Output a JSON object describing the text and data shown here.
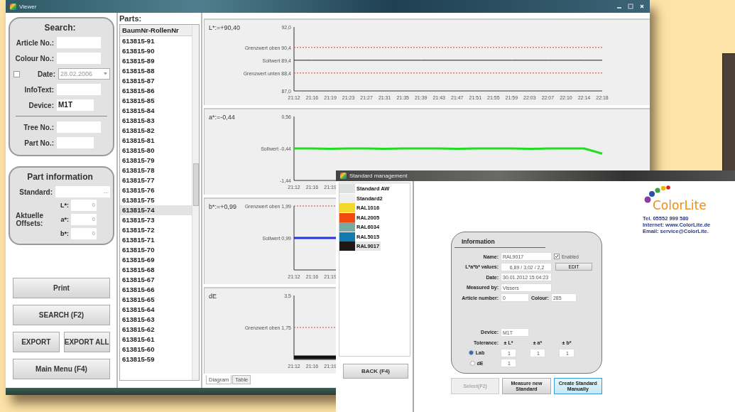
{
  "viewer": {
    "title": "Viewer",
    "search": {
      "heading": "Search:",
      "fields": [
        {
          "label": "Article No.:",
          "kind": "text"
        },
        {
          "label": "Colour No.:",
          "kind": "text"
        },
        {
          "label": "Date:",
          "kind": "date",
          "value": "28.02.2006",
          "checked": false
        },
        {
          "label": "InfoText:",
          "kind": "text"
        },
        {
          "label": "Device:",
          "kind": "short",
          "value": "M1T"
        }
      ],
      "part_fields": [
        {
          "label": "Tree No.:",
          "kind": "text"
        },
        {
          "label": "Part No.:",
          "kind": "short"
        }
      ]
    },
    "part_information": {
      "heading": "Part information",
      "standard_label": "Standard:",
      "standard_button": "...",
      "offsets_label": "Aktuelle Offsets:",
      "offsets": [
        {
          "label": "L*:",
          "value": "0"
        },
        {
          "label": "a*:",
          "value": "0"
        },
        {
          "label": "b*:",
          "value": "0"
        }
      ]
    },
    "buttons": [
      "Print",
      "SEARCH (F2)",
      "EXPORT",
      "EXPORT ALL",
      "Main Menu (F4)"
    ],
    "parts": {
      "heading": "Parts:",
      "column": "BaumNr-RollenNr",
      "rows": [
        {
          "text": "613815-91",
          "selected": false
        },
        {
          "text": "613815-90",
          "selected": false
        },
        {
          "text": "613815-89",
          "selected": false
        },
        {
          "text": "613815-88",
          "selected": false
        },
        {
          "text": "613815-87",
          "selected": false
        },
        {
          "text": "613815-86",
          "selected": false
        },
        {
          "text": "613815-85",
          "selected": false
        },
        {
          "text": "613815-84",
          "selected": false
        },
        {
          "text": "613815-83",
          "selected": false
        },
        {
          "text": "613815-82",
          "selected": false
        },
        {
          "text": "613815-81",
          "selected": false
        },
        {
          "text": "613815-80",
          "selected": false
        },
        {
          "text": "613815-79",
          "selected": false
        },
        {
          "text": "613815-78",
          "selected": false
        },
        {
          "text": "613815-77",
          "selected": false
        },
        {
          "text": "613815-76",
          "selected": false
        },
        {
          "text": "613815-75",
          "selected": false
        },
        {
          "text": "613815-74",
          "selected": true
        },
        {
          "text": "613815-73",
          "selected": false
        },
        {
          "text": "613815-72",
          "selected": false
        },
        {
          "text": "613815-71",
          "selected": false
        },
        {
          "text": "613815-70",
          "selected": false
        },
        {
          "text": "613815-69",
          "selected": false
        },
        {
          "text": "613815-68",
          "selected": false
        },
        {
          "text": "613815-67",
          "selected": false
        },
        {
          "text": "613815-66",
          "selected": false
        },
        {
          "text": "613815-65",
          "selected": false
        },
        {
          "text": "613815-64",
          "selected": false
        },
        {
          "text": "613815-63",
          "selected": false
        },
        {
          "text": "613815-62",
          "selected": false
        },
        {
          "text": "613815-61",
          "selected": false
        },
        {
          "text": "613815-60",
          "selected": false
        },
        {
          "text": "613815-59",
          "selected": false
        }
      ]
    },
    "charts": [
      {
        "label": "L*:=+90,40",
        "chart_data": {
          "type": "line",
          "ylim": [
            87,
            92
          ],
          "yticks": [
            {
              "value": 92,
              "label": "92,0"
            },
            {
              "value": 90.4,
              "label": "Grenzwert oben 90,4"
            },
            {
              "value": 89.4,
              "label": "Sollwert 89,4"
            },
            {
              "value": 88.4,
              "label": "Grenzwert unten 88,4"
            },
            {
              "value": 87,
              "label": "87,0"
            }
          ],
          "categories": [
            "21:12",
            "21:16",
            "21:19",
            "21:23",
            "21:27",
            "21:31",
            "21:35",
            "21:39",
            "21:43",
            "21:47",
            "21:51",
            "21:55",
            "21:59",
            "22:03",
            "22:07",
            "22:10",
            "22:14",
            "22:18"
          ],
          "series": [
            {
              "color": "#d04040",
              "line_style": "dashed",
              "values": [
                90.4,
                90.4,
                90.4,
                90.4,
                90.4,
                90.4,
                90.4,
                90.4,
                90.4,
                90.4,
                90.4,
                90.4,
                90.4,
                90.4,
                90.4,
                90.4,
                90.4,
                90.4
              ]
            },
            {
              "color": "#222222",
              "line_style": "solid",
              "values": [
                89.4,
                89.4,
                89.4,
                89.4,
                89.4,
                89.4,
                89.4,
                89.4,
                89.4,
                89.4,
                89.4,
                89.4,
                89.4,
                89.4,
                89.4,
                89.4,
                89.4,
                89.4
              ]
            },
            {
              "color": "#d04040",
              "line_style": "dashed",
              "values": [
                88.4,
                88.4,
                88.4,
                88.4,
                88.4,
                88.4,
                88.4,
                88.4,
                88.4,
                88.4,
                88.4,
                88.4,
                88.4,
                88.4,
                88.4,
                88.4,
                88.4,
                88.4
              ]
            }
          ]
        }
      },
      {
        "label": "a*:=-0,44",
        "chart_data": {
          "type": "line",
          "ylim": [
            -1.44,
            0.56
          ],
          "yticks": [
            {
              "value": 0.56,
              "label": "0,56"
            },
            {
              "value": -0.44,
              "label": "Sollwert -0,44"
            },
            {
              "value": -1.44,
              "label": "-1,44"
            }
          ],
          "categories": [
            "21:12",
            "21:16",
            "21:19",
            null,
            null,
            null,
            null,
            null,
            null,
            null,
            null,
            null,
            null,
            null,
            null,
            null,
            null,
            null
          ],
          "series": [
            {
              "color": "#22dd22",
              "line_style": "solid",
              "values": [
                -0.44,
                -0.44,
                -0.45,
                -0.44,
                -0.44,
                -0.45,
                -0.44,
                -0.44,
                -0.44,
                -0.45,
                -0.44,
                -0.44,
                -0.44,
                -0.45,
                -0.44,
                -0.44,
                -0.44,
                -0.6
              ]
            }
          ]
        }
      },
      {
        "label": "b*:=+0,99",
        "reference_labels": [
          {
            "text": "Grenzwert oben 1,99",
            "kind": "limit"
          },
          {
            "text": "Sollwert 0,99",
            "kind": "target"
          }
        ],
        "x_labels": [
          "21:12",
          "21:16",
          "21:19"
        ]
      },
      {
        "label": "dE",
        "top_label": "3,5",
        "reference_labels": [
          {
            "text": "Grenzwert oben 1,75",
            "kind": "limit"
          }
        ],
        "x_labels": [
          "21:12",
          "21:16",
          "21:19"
        ]
      }
    ],
    "chart_tabs": [
      {
        "label": "Diagram",
        "selected": true
      },
      {
        "label": "Table",
        "selected": false
      }
    ]
  },
  "standard_management": {
    "title": "Standard management",
    "standards": [
      {
        "name": "Standard AW",
        "color": "#dde1e2",
        "selected": false
      },
      {
        "name": "Standard2",
        "color": "#eeeeec",
        "selected": false
      },
      {
        "name": "RAL1016",
        "color": "#f2d82a",
        "selected": false
      },
      {
        "name": "RAL2005",
        "color": "#f04a10",
        "selected": false
      },
      {
        "name": "RAL6034",
        "color": "#7aa9a4",
        "selected": false
      },
      {
        "name": "RAL5015",
        "color": "#1178b0",
        "selected": false
      },
      {
        "name": "RAL9017",
        "color": "#1e1715",
        "selected": true
      }
    ],
    "back_button": "BACK (F4)",
    "information": {
      "heading": "Information",
      "name": {
        "label": "Name:",
        "value": "RAL9017",
        "enabled_label": "Enabled",
        "enabled": true
      },
      "lab": {
        "label": "L*a*b* values:",
        "value": "6,89 / 3,02 / 2,2",
        "button": "EDIT"
      },
      "date": {
        "label": "Date:",
        "value": "30.01.2012 15:04:23"
      },
      "measured_by": {
        "label": "Measured by:",
        "value": "Vissers"
      },
      "article": {
        "label": "Article number:",
        "value": "0",
        "colour_label": "Colour:",
        "colour_value": "285"
      },
      "device": {
        "label": "Device:",
        "value": "M1T"
      },
      "tolerance": {
        "label": "Tolerance:",
        "columns": [
          "± L*",
          "± a*",
          "± b*"
        ],
        "options": [
          {
            "label": "Lab",
            "selected": true,
            "values": [
              "1",
              "1",
              "1"
            ]
          },
          {
            "label": "dE",
            "selected": false,
            "values": [
              "1"
            ]
          }
        ]
      }
    },
    "buttons": [
      {
        "label": "Select(F2)",
        "disabled": true,
        "highlighted": false
      },
      {
        "label": "Measure new Standard",
        "disabled": false,
        "highlighted": false
      },
      {
        "label": "Create Standard Manually",
        "disabled": false,
        "highlighted": true
      }
    ],
    "logo": {
      "brand": "ColorLite",
      "contact": [
        "Tel. 05552 999 580",
        "Internet: www.ColorLite.de",
        "Email: service@ColorLite."
      ]
    }
  }
}
